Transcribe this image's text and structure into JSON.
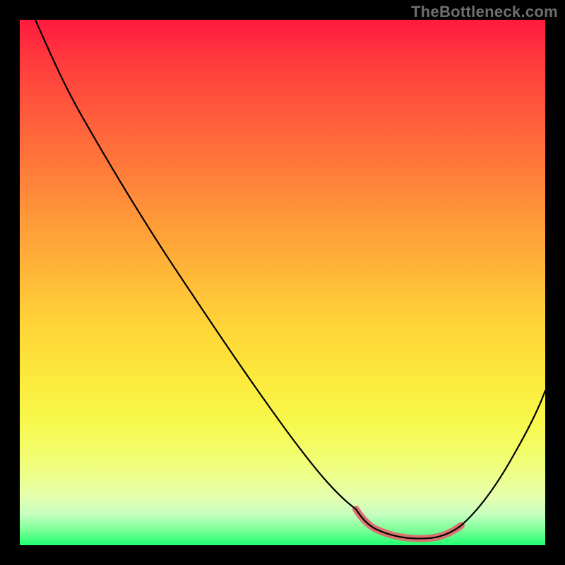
{
  "watermark": "TheBottleneck.com",
  "chart_data": {
    "type": "line",
    "title": "",
    "xlabel": "",
    "ylabel": "",
    "xlim": [
      0,
      100
    ],
    "ylim": [
      0,
      100
    ],
    "grid": false,
    "series": [
      {
        "name": "bottleneck-curve",
        "x": [
          3,
          10,
          20,
          30,
          40,
          50,
          58,
          64,
          68,
          72,
          76,
          80,
          84,
          88,
          92,
          96,
          100
        ],
        "y": [
          100,
          90,
          76,
          62,
          48,
          34,
          22,
          13,
          7,
          3,
          1,
          1,
          2,
          7,
          15,
          25,
          36
        ]
      }
    ],
    "highlight_range": {
      "x_start": 64,
      "x_end": 84,
      "label": "optimal-zone"
    },
    "background": "rainbow-gradient-red-to-green"
  }
}
